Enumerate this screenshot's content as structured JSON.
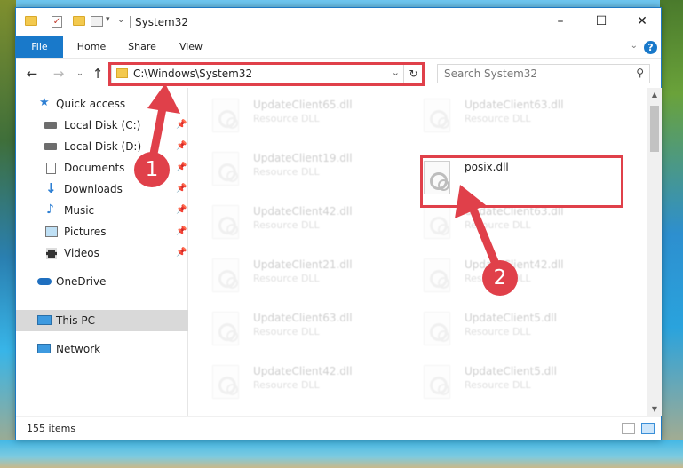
{
  "window": {
    "title": "System32",
    "controls": {
      "minimize": "–",
      "maximize": "☐",
      "close": "✕"
    }
  },
  "ribbon": {
    "tabs": [
      {
        "label": "File"
      },
      {
        "label": "Home"
      },
      {
        "label": "Share"
      },
      {
        "label": "View"
      }
    ]
  },
  "nav": {
    "address": "C:\\Windows\\System32",
    "search_placeholder": "Search System32"
  },
  "sidebar": {
    "items": [
      {
        "label": "Quick access",
        "icon": "star-icon"
      },
      {
        "label": "Local Disk (C:)",
        "icon": "drive-icon"
      },
      {
        "label": "Local Disk (D:)",
        "icon": "drive-icon"
      },
      {
        "label": "Documents",
        "icon": "documents-icon"
      },
      {
        "label": "Downloads",
        "icon": "downloads-icon"
      },
      {
        "label": "Music",
        "icon": "music-icon"
      },
      {
        "label": "Pictures",
        "icon": "pictures-icon"
      },
      {
        "label": "Videos",
        "icon": "videos-icon"
      },
      {
        "label": "OneDrive",
        "icon": "cloud-icon"
      },
      {
        "label": "This PC",
        "icon": "computer-icon"
      },
      {
        "label": "Network",
        "icon": "network-icon"
      }
    ]
  },
  "files": {
    "left": [
      {
        "name": "UpdateClient65.dll",
        "type": "Resource DLL"
      },
      {
        "name": "UpdateClient19.dll",
        "type": "Resource DLL"
      },
      {
        "name": "UpdateClient42.dll",
        "type": "Resource DLL"
      },
      {
        "name": "UpdateClient21.dll",
        "type": "Resource DLL"
      },
      {
        "name": "UpdateClient63.dll",
        "type": "Resource DLL"
      },
      {
        "name": "UpdateClient42.dll",
        "type": "Resource DLL"
      }
    ],
    "right": [
      {
        "name": "UpdateClient63.dll",
        "type": "Resource DLL"
      },
      {
        "name": "posix.dll",
        "type": ""
      },
      {
        "name": "UpdateClient63.dll",
        "type": "Resource DLL"
      },
      {
        "name": "UpdateClient42.dll",
        "type": "Resource DLL"
      },
      {
        "name": "UpdateClient5.dll",
        "type": "Resource DLL"
      },
      {
        "name": "UpdateClient5.dll",
        "type": "Resource DLL"
      }
    ]
  },
  "status": {
    "item_count": "155 items"
  },
  "annotations": {
    "step1": "1",
    "step2": "2",
    "color": "#e0404a"
  }
}
